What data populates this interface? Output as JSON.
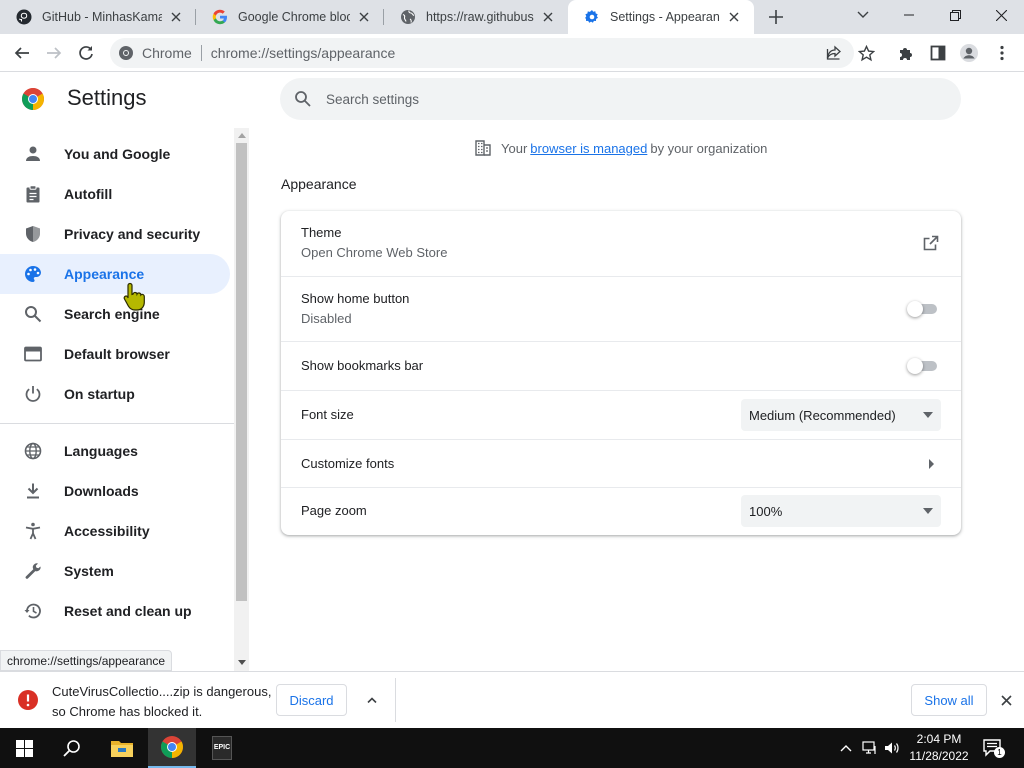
{
  "tabs": [
    {
      "title": "GitHub - MinhasKamal/CuteVirusCollection",
      "icon": "github-icon"
    },
    {
      "title": "Google Chrome blocks download",
      "icon": "google-icon"
    },
    {
      "title": "https://raw.githubusercontent.com",
      "icon": "globe-icon"
    },
    {
      "title": "Settings - Appearance",
      "icon": "gear-icon",
      "active": true
    }
  ],
  "toolbar": {
    "site_chip": "Chrome",
    "url": "chrome://settings/appearance"
  },
  "header": {
    "title": "Settings",
    "search_placeholder": "Search settings"
  },
  "sidebar": {
    "items": [
      {
        "label": "You and Google",
        "icon": "person-icon"
      },
      {
        "label": "Autofill",
        "icon": "clipboard-icon"
      },
      {
        "label": "Privacy and security",
        "icon": "shield-icon"
      },
      {
        "label": "Appearance",
        "icon": "palette-icon",
        "selected": true
      },
      {
        "label": "Search engine",
        "icon": "search-icon"
      },
      {
        "label": "Default browser",
        "icon": "browser-icon"
      },
      {
        "label": "On startup",
        "icon": "power-icon"
      },
      {
        "label": "Languages",
        "icon": "globe-icon"
      },
      {
        "label": "Downloads",
        "icon": "download-icon"
      },
      {
        "label": "Accessibility",
        "icon": "accessibility-icon"
      },
      {
        "label": "System",
        "icon": "wrench-icon"
      },
      {
        "label": "Reset and clean up",
        "icon": "history-icon"
      }
    ]
  },
  "status_url": "chrome://settings/appearance",
  "managed": {
    "prefix": "Your",
    "link": "browser is managed",
    "suffix": "by your organization"
  },
  "section": {
    "title": "Appearance",
    "rows": {
      "theme": {
        "label": "Theme",
        "sublabel": "Open Chrome Web Store"
      },
      "home_button": {
        "label": "Show home button",
        "sublabel": "Disabled",
        "enabled": false
      },
      "bookmarks_bar": {
        "label": "Show bookmarks bar",
        "enabled": false
      },
      "font_size": {
        "label": "Font size",
        "value": "Medium (Recommended)"
      },
      "customize_fonts": {
        "label": "Customize fonts"
      },
      "page_zoom": {
        "label": "Page zoom",
        "value": "100%"
      }
    }
  },
  "download": {
    "line1": "CuteVirusCollectio....zip is dangerous,",
    "line2": "so Chrome has blocked it.",
    "discard_label": "Discard",
    "show_all_label": "Show all"
  },
  "taskbar": {
    "time": "2:04 PM",
    "date": "11/28/2022",
    "notification_count": "1",
    "epic_label": "EPIC"
  },
  "colors": {
    "accent": "#1a73e8",
    "selected_bg": "#e8f0fe",
    "danger": "#d93025",
    "taskbar": "#101010"
  }
}
